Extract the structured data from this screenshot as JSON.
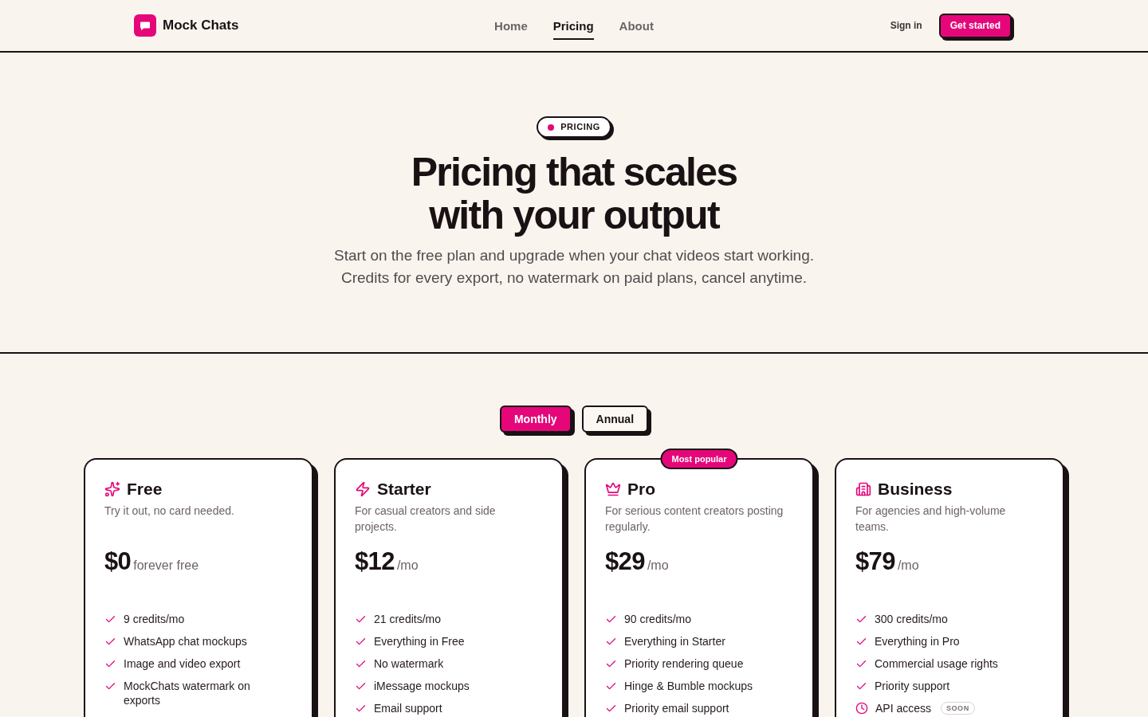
{
  "nav": {
    "brand": "Mock Chats",
    "links": [
      {
        "label": "Home",
        "selected": false
      },
      {
        "label": "Pricing",
        "selected": true
      },
      {
        "label": "About",
        "selected": false
      }
    ],
    "sign_in": "Sign in",
    "cta": "Get started"
  },
  "hero": {
    "badge": "PRICING",
    "title_lines": [
      "Pricing that scales",
      "with your output"
    ],
    "subtitle_lines": [
      "Start on the free plan and upgrade when your chat videos start working.",
      "Credits for every export, no watermark on paid plans, cancel anytime."
    ]
  },
  "billing_toggle": [
    {
      "label": "Monthly",
      "selected": true
    },
    {
      "label": "Annual",
      "selected": false
    }
  ],
  "plans": [
    {
      "name": "Free",
      "description": "Try it out, no card needed.",
      "price": "$0",
      "price_suffix": "forever free",
      "features": [
        {
          "kind": "included",
          "text": "9 credits/mo"
        },
        {
          "kind": "included",
          "text": "WhatsApp chat mockups"
        },
        {
          "kind": "included",
          "text": "Image and video export"
        },
        {
          "kind": "included",
          "text": "MockChats watermark on exports"
        }
      ]
    },
    {
      "name": "Starter",
      "description": "For casual creators and side projects.",
      "price": "$12",
      "price_suffix": "/mo",
      "features": [
        {
          "kind": "included",
          "text": "21 credits/mo"
        },
        {
          "kind": "included",
          "text": "Everything in Free"
        },
        {
          "kind": "included",
          "text": "No watermark"
        },
        {
          "kind": "included",
          "text": "iMessage mockups"
        },
        {
          "kind": "included",
          "text": "Email support"
        }
      ]
    },
    {
      "name": "Pro",
      "badge": "Most popular",
      "description": "For serious content creators posting regularly.",
      "price": "$29",
      "price_suffix": "/mo",
      "features": [
        {
          "kind": "included",
          "text": "90 credits/mo"
        },
        {
          "kind": "included",
          "text": "Everything in Starter"
        },
        {
          "kind": "included",
          "text": "Priority rendering queue"
        },
        {
          "kind": "included",
          "text": "Hinge & Bumble mockups"
        },
        {
          "kind": "included",
          "text": "Priority email support"
        }
      ]
    },
    {
      "name": "Business",
      "description": "For agencies and high-volume teams.",
      "price": "$79",
      "price_suffix": "/mo",
      "features": [
        {
          "kind": "included",
          "text": "300 credits/mo"
        },
        {
          "kind": "included",
          "text": "Everything in Pro"
        },
        {
          "kind": "included",
          "text": "Commercial usage rights"
        },
        {
          "kind": "included",
          "text": "Priority support"
        },
        {
          "kind": "upcoming",
          "text": "API access",
          "tag": "SOON"
        }
      ]
    }
  ]
}
